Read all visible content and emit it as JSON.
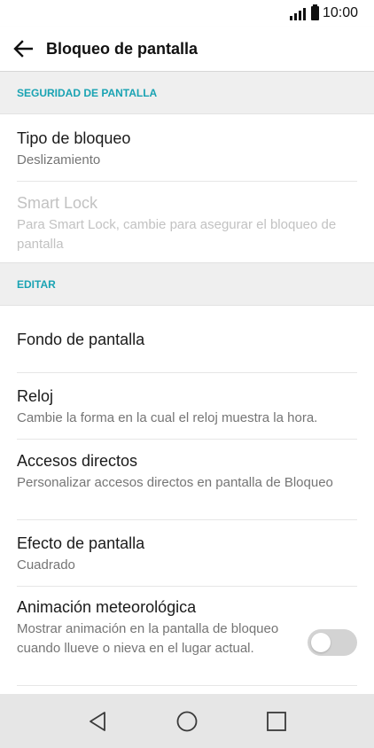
{
  "status_bar": {
    "time": "10:00"
  },
  "app_bar": {
    "title": "Bloqueo de pantalla",
    "back_icon": "arrow-left-icon"
  },
  "sections": [
    {
      "header": "SEGURIDAD DE PANTALLA",
      "items": [
        {
          "title": "Tipo de bloqueo",
          "subtitle": "Deslizamiento",
          "enabled": true
        },
        {
          "title": "Smart Lock",
          "subtitle": "Para Smart Lock, cambie para asegurar el bloqueo de pantalla",
          "enabled": false
        }
      ]
    },
    {
      "header": "EDITAR",
      "items": [
        {
          "title": "Fondo de pantalla",
          "subtitle": "",
          "enabled": true
        },
        {
          "title": "Reloj",
          "subtitle": "Cambie la forma en la cual el reloj muestra la hora.",
          "enabled": true
        },
        {
          "title": "Accesos directos",
          "subtitle": "Personalizar accesos directos en pantalla de Bloqueo",
          "enabled": true
        },
        {
          "title": "Efecto de pantalla",
          "subtitle": "Cuadrado",
          "enabled": true
        },
        {
          "title": "Animación meteorológica",
          "subtitle": "Mostrar animación en la pantalla de bloqueo cuando llueve o nieva en el lugar actual.",
          "enabled": true,
          "toggle": false
        }
      ]
    }
  ],
  "nav_bar": {
    "back_icon": "triangle-back-icon",
    "home_icon": "circle-home-icon",
    "recents_icon": "square-recents-icon",
    "background_color": "#e6e6e6"
  },
  "colors": {
    "section_header": "#1aa3b3",
    "section_background": "#efefef",
    "toggle_off": "#d3d3d3"
  }
}
